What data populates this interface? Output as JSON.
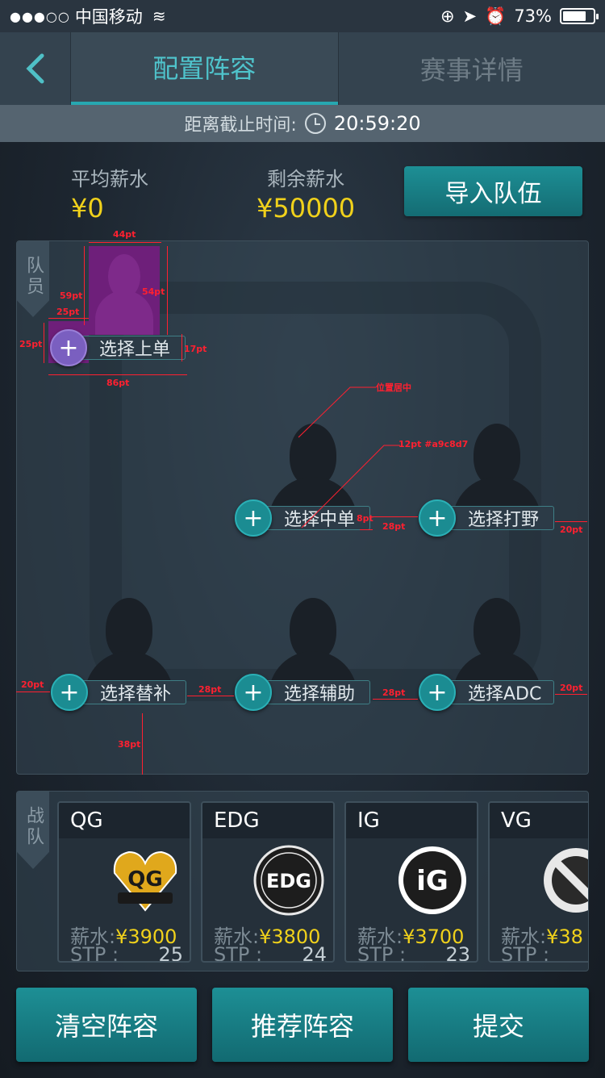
{
  "status_bar": {
    "signal": "●●●○○",
    "carrier": "中国移动",
    "battery": "73%"
  },
  "nav": {
    "tabs": [
      {
        "label": "配置阵容",
        "active": true
      },
      {
        "label": "赛事详情",
        "active": false
      }
    ]
  },
  "deadline": {
    "label": "距离截止时间:",
    "time": "20:59:20"
  },
  "salary": {
    "avg_label": "平均薪水",
    "avg_value": "¥0",
    "remain_label": "剩余薪水",
    "remain_value": "¥50000",
    "import_button": "导入队伍"
  },
  "lineup": {
    "tag": "队员",
    "slots": {
      "top": "选择上单",
      "mid": "选择中单",
      "jungle": "选择打野",
      "sub": "选择替补",
      "support": "选择辅助",
      "adc": "选择ADC"
    },
    "annotations": {
      "w44": "44pt",
      "h54": "54pt",
      "h59": "59pt",
      "w25": "25pt",
      "h25": "25pt",
      "h17": "17pt",
      "w86": "86pt",
      "center": "位置居中",
      "font": "12pt #a9c8d7",
      "gap8": "8pt",
      "gap28a": "28pt",
      "edge20a": "20pt",
      "edge20b": "20pt",
      "gap28b": "28pt",
      "gap28c": "28pt",
      "edge20c": "20pt",
      "h38": "38pt"
    }
  },
  "teams": {
    "tag": "战队",
    "salary_label": "薪水:",
    "stp_label": "STP :",
    "list": [
      {
        "name": "QG",
        "salary": "¥3900",
        "stp": "25",
        "logo_text": "QG"
      },
      {
        "name": "EDG",
        "salary": "¥3800",
        "stp": "24",
        "logo_text": "EDG"
      },
      {
        "name": "IG",
        "salary": "¥3700",
        "stp": "23",
        "logo_text": "iG"
      },
      {
        "name": "VG",
        "salary": "¥38",
        "stp": "",
        "logo_text": ""
      }
    ]
  },
  "actions": {
    "clear": "清空阵容",
    "recommend": "推荐阵容",
    "submit": "提交"
  },
  "colors": {
    "accent": "#1b8c92",
    "gold": "#f0d11b",
    "annotation": "#ff2030"
  }
}
